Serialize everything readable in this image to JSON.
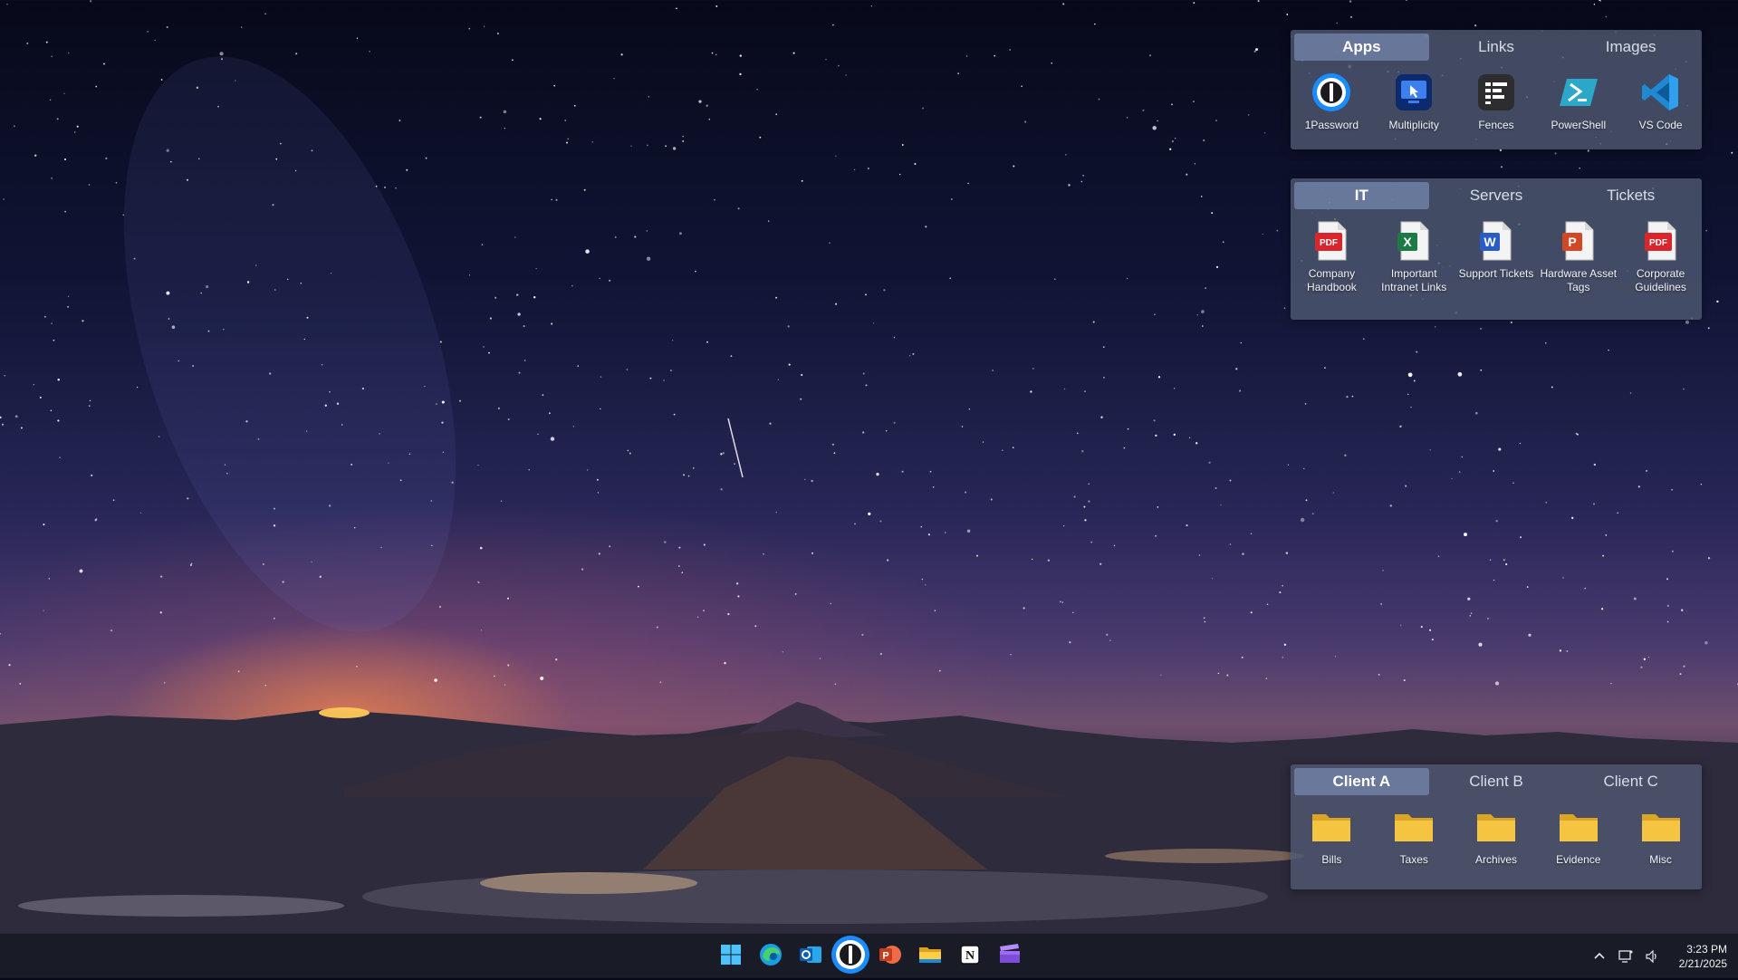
{
  "fences": [
    {
      "tabs": [
        "Apps",
        "Links",
        "Images"
      ],
      "active_tab": 0,
      "items": [
        {
          "label": "1Password",
          "icon": "1password-icon"
        },
        {
          "label": "Multiplicity",
          "icon": "multiplicity-icon"
        },
        {
          "label": "Fences",
          "icon": "fences-icon"
        },
        {
          "label": "PowerShell",
          "icon": "powershell-icon"
        },
        {
          "label": "VS Code",
          "icon": "vscode-icon"
        }
      ]
    },
    {
      "tabs": [
        "IT",
        "Servers",
        "Tickets"
      ],
      "active_tab": 0,
      "items": [
        {
          "label": "Company Handbook",
          "icon": "pdf-file-icon",
          "badge": "PDF"
        },
        {
          "label": "Important Intranet Links",
          "icon": "excel-file-icon",
          "badge": "X"
        },
        {
          "label": "Support Tickets",
          "icon": "word-file-icon",
          "badge": "W"
        },
        {
          "label": "Hardware Asset Tags",
          "icon": "powerpoint-file-icon",
          "badge": "P"
        },
        {
          "label": "Corporate Guidelines",
          "icon": "pdf-file-icon",
          "badge": "PDF"
        }
      ]
    },
    {
      "tabs": [
        "Client A",
        "Client B",
        "Client C"
      ],
      "active_tab": 0,
      "items": [
        {
          "label": "Bills",
          "icon": "folder-icon"
        },
        {
          "label": "Taxes",
          "icon": "folder-icon"
        },
        {
          "label": "Archives",
          "icon": "folder-icon"
        },
        {
          "label": "Evidence",
          "icon": "folder-icon"
        },
        {
          "label": "Misc",
          "icon": "folder-icon"
        }
      ]
    }
  ],
  "taskbar": {
    "apps": [
      {
        "icon": "windows-start-icon"
      },
      {
        "icon": "edge-icon"
      },
      {
        "icon": "outlook-icon"
      },
      {
        "icon": "1password-icon"
      },
      {
        "icon": "powerpoint-icon"
      },
      {
        "icon": "file-explorer-icon"
      },
      {
        "icon": "notion-icon"
      },
      {
        "icon": "clipchamp-icon"
      }
    ],
    "time": "3:23 PM",
    "date": "2/21/2025"
  },
  "colors": {
    "fence_bg": "#4e5870",
    "active_tab": "#8296be",
    "folder": "#f5c542",
    "pdf_red": "#d9262c",
    "excel_green": "#1d7a45",
    "word_blue": "#2b5cc5",
    "ppt_orange": "#d24726"
  }
}
